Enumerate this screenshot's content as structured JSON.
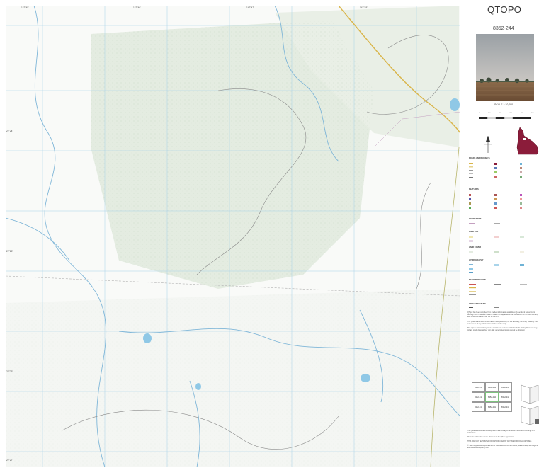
{
  "brand": "QTOPO",
  "sheet_number": "8352-244",
  "scale_text": "SCALE 1:10,000",
  "scale_ticks": [
    "0",
    "100",
    "200",
    "300",
    "400",
    "500 m"
  ],
  "grid_labels": {
    "top": [
      "147°45'",
      "147°46'",
      "147°47'",
      "147°48'"
    ],
    "left": [
      "22°24'",
      "22°25'",
      "22°26'",
      "22°27'"
    ]
  },
  "legend": {
    "headings": [
      "ROADS AND RAILWAYS",
      "FEATURES",
      "BOUNDARIES",
      "LAND USE",
      "LAND COVER",
      "HYDROGRAPHY",
      "TRANSPORTATION",
      "INFRASTRUCTURE"
    ]
  },
  "disclaimer": [
    "QTopo has been compiled from the best information available to Queensland Government. Although effort has been made to make the map as accurate reference, it is not field-checked, and some information may not be current.",
    "The Queensland Government takes no responsibility for the accuracy, currency, reliability and correctness of any information included on the map.",
    "The representation of any road or track is not evidence of Public Right of Way. Persons using private roads do so at their own risk; owners' permission should be obtained."
  ],
  "grid_index": [
    [
      "8352-143",
      "8352-243",
      "8352-343"
    ],
    [
      "8352-144",
      "8352-244",
      "8352-344"
    ],
    [
      "8352-141",
      "8352-241",
      "8352-341"
    ]
  ],
  "footer": [
    "The Queensland Government supports and encourages the dissemination and exchange of its information.",
    "Metadata information can be obtained via the QTopo application.",
    "THIS MAP MAY BE PRINTED OR REPRODUCED BY ANYONE FOR NON-PURPOSES",
    "© State of Queensland (Department of Natural Resources and Mines, Manufacturing and Regional and Rural Development) 2023"
  ],
  "colors": {
    "accent": "#8b1c3a",
    "water": "#6fb3d6",
    "veg": "#e3ece0",
    "road": "#e0b84a"
  }
}
